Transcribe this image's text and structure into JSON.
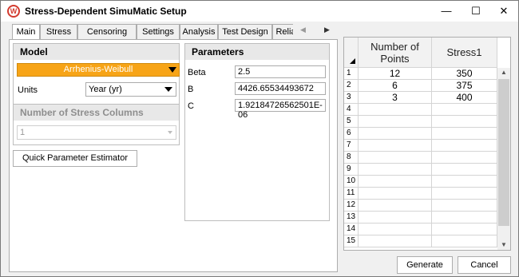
{
  "window": {
    "title": "Stress-Dependent SimuMatic Setup",
    "icon_letter": "W",
    "minimize_glyph": "—",
    "maximize_glyph": "☐",
    "close_glyph": "✕"
  },
  "tabs": [
    {
      "label": "Main",
      "active": true
    },
    {
      "label": "Stress"
    },
    {
      "label": "Censoring"
    },
    {
      "label": "Settings"
    },
    {
      "label": "Analysis"
    },
    {
      "label": "Test Design"
    },
    {
      "label": "Reliabil"
    }
  ],
  "tab_scroll": {
    "left_glyph": "◀",
    "right_glyph": "▶"
  },
  "model": {
    "title": "Model",
    "selected": "Arrhenius-Weibull",
    "units_label": "Units",
    "units_value": "Year (yr)"
  },
  "stress_columns": {
    "title": "Number of Stress Columns",
    "value": "1"
  },
  "quick_button": "Quick Parameter Estimator",
  "parameters": {
    "title": "Parameters",
    "items": [
      {
        "label": "Beta",
        "value": "2.5"
      },
      {
        "label": "B",
        "value": "4426.65534493672"
      },
      {
        "label": "C",
        "value": "1.92184726562501E-06"
      }
    ]
  },
  "grid": {
    "headers": [
      "Number of Points",
      "Stress1"
    ],
    "rows": [
      {
        "n": "1",
        "points": "12",
        "stress": "350"
      },
      {
        "n": "2",
        "points": "6",
        "stress": "375"
      },
      {
        "n": "3",
        "points": "3",
        "stress": "400"
      },
      {
        "n": "4",
        "points": "",
        "stress": ""
      },
      {
        "n": "5",
        "points": "",
        "stress": ""
      },
      {
        "n": "6",
        "points": "",
        "stress": ""
      },
      {
        "n": "7",
        "points": "",
        "stress": ""
      },
      {
        "n": "8",
        "points": "",
        "stress": ""
      },
      {
        "n": "9",
        "points": "",
        "stress": ""
      },
      {
        "n": "10",
        "points": "",
        "stress": ""
      },
      {
        "n": "11",
        "points": "",
        "stress": ""
      },
      {
        "n": "12",
        "points": "",
        "stress": ""
      },
      {
        "n": "13",
        "points": "",
        "stress": ""
      },
      {
        "n": "14",
        "points": "",
        "stress": ""
      },
      {
        "n": "15",
        "points": "",
        "stress": ""
      }
    ]
  },
  "buttons": {
    "generate": "Generate",
    "cancel": "Cancel"
  },
  "colors": {
    "accent": "#f7a417",
    "app_icon": "#d33b2f"
  }
}
